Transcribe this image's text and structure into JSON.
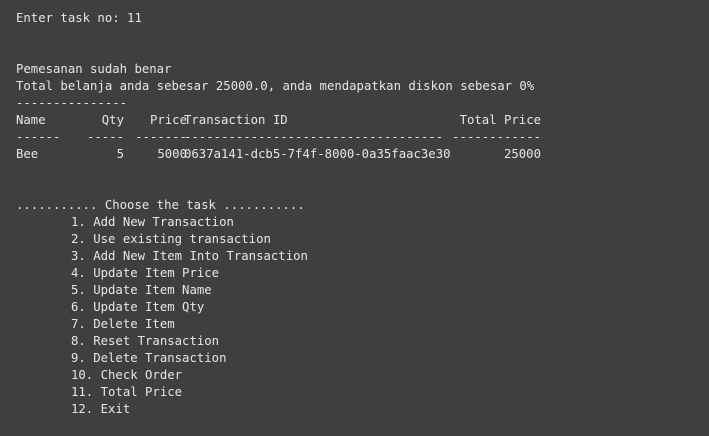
{
  "prompt": {
    "text": "Enter task no: 11"
  },
  "status": {
    "confirmation": "Pemesanan sudah benar",
    "total_message": "Total belanja anda sebesar 25000.0, anda mendapatkan diskon sebesar 0%",
    "separator": "---------------"
  },
  "table": {
    "headers": {
      "name": "Name",
      "qty": "Qty",
      "price": "Price",
      "transaction_id": "Transaction ID",
      "total_price": "Total Price"
    },
    "underlines": {
      "name": "------",
      "qty": "-----",
      "price": "-------",
      "transaction_id": "-----------------------------------",
      "total_price": "------------"
    },
    "rows": [
      {
        "name": "Bee",
        "qty": "5",
        "price": "5000",
        "transaction_id": "0637a141-dcb5-7f4f-8000-0a35faac3e30",
        "total_price": "25000"
      }
    ]
  },
  "menu": {
    "title": "........... Choose the task ...........",
    "items": [
      "1. Add New Transaction",
      "2. Use existing transaction",
      "3. Add New Item Into Transaction",
      "4. Update Item Price",
      "5. Update Item Name",
      "6. Update Item Qty",
      "7. Delete Item",
      "8. Reset Transaction",
      "9. Delete Transaction",
      "10. Check Order",
      "11. Total Price",
      "12. Exit"
    ]
  }
}
